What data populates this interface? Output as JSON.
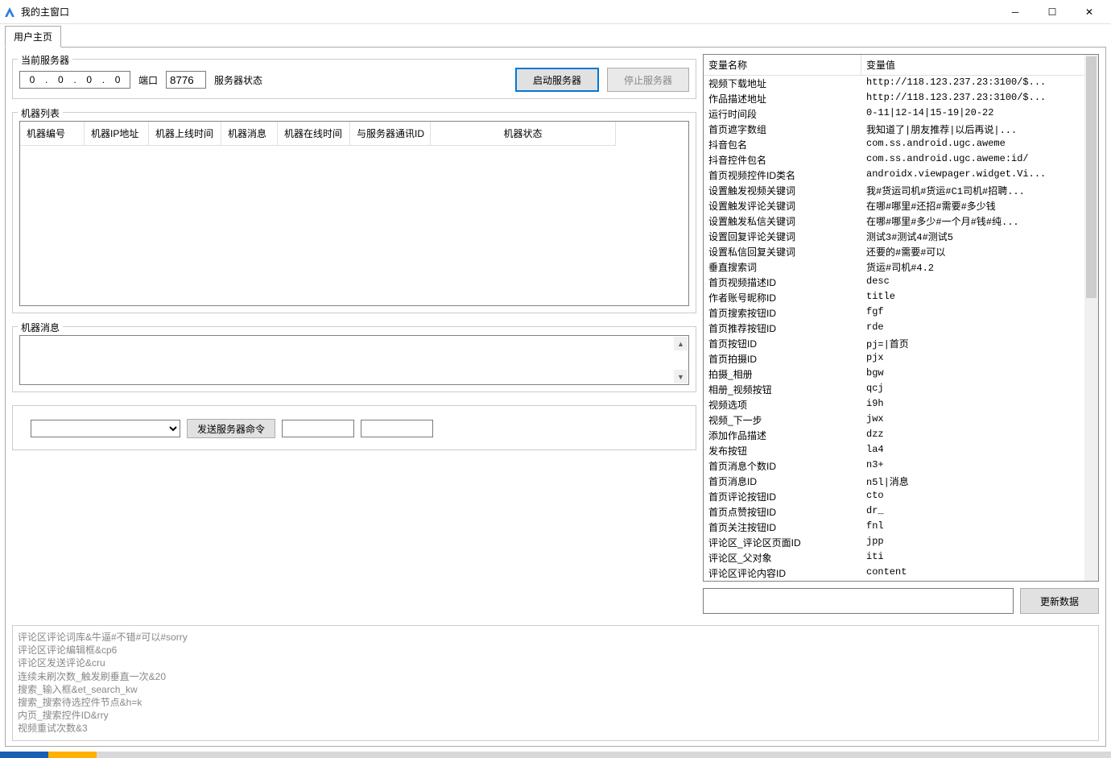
{
  "window": {
    "title": "我的主窗口"
  },
  "tab": {
    "label": "用户主页"
  },
  "server_group": {
    "title": "当前服务器",
    "ip": [
      "0",
      "0",
      "0",
      "0"
    ],
    "port_label": "端口",
    "port_value": "8776",
    "status_label": "服务器状态",
    "start_btn": "启动服务器",
    "stop_btn": "停止服务器"
  },
  "machine_list": {
    "title": "机器列表",
    "headers": [
      "机器编号",
      "机器IP地址",
      "机器上线时间",
      "机器消息",
      "机器在线时间",
      "与服务器通讯ID",
      "机器状态"
    ]
  },
  "machine_msg": {
    "title": "机器消息"
  },
  "command": {
    "send_btn": "发送服务器命令"
  },
  "log_lines": [
    "评论区评论词库&牛逼#不错#可以#sorry",
    "评论区评论编辑框&cp6",
    "评论区发送评论&cru",
    "连续未刷次数_触发刷垂直一次&20",
    "搜索_输入框&et_search_kw",
    "搜索_搜索待选控件节点&h=k",
    "内页_搜索控件ID&rry",
    "视频重试次数&3"
  ],
  "var_table": {
    "header_name": "变量名称",
    "header_value": "变量值",
    "rows": [
      {
        "name": "视频下载地址",
        "value": "http://118.123.237.23:3100/$..."
      },
      {
        "name": "作品描述地址",
        "value": "http://118.123.237.23:3100/$..."
      },
      {
        "name": "运行时间段",
        "value": "0-11|12-14|15-19|20-22"
      },
      {
        "name": "首页遮字数组",
        "value": "我知道了|朋友推荐|以后再说|..."
      },
      {
        "name": "抖音包名",
        "value": "com.ss.android.ugc.aweme"
      },
      {
        "name": "抖音控件包名",
        "value": "com.ss.android.ugc.aweme:id/"
      },
      {
        "name": "首页视频控件ID类名",
        "value": "androidx.viewpager.widget.Vi..."
      },
      {
        "name": "设置触发视频关键词",
        "value": "我#货运司机#货运#C1司机#招聘..."
      },
      {
        "name": "设置触发评论关键词",
        "value": "在哪#哪里#还招#需要#多少钱"
      },
      {
        "name": "设置触发私信关键词",
        "value": "在哪#哪里#多少#一个月#钱#纯..."
      },
      {
        "name": "设置回复评论关键词",
        "value": "测试3#测试4#测试5"
      },
      {
        "name": "设置私信回复关键词",
        "value": "还要的#需要#可以"
      },
      {
        "name": "垂直搜索词",
        "value": "货运#司机#4.2"
      },
      {
        "name": "首页视频描述ID",
        "value": "desc"
      },
      {
        "name": "作者账号昵称ID",
        "value": "title"
      },
      {
        "name": "首页搜索按钮ID",
        "value": "fgf"
      },
      {
        "name": "首页推荐按钮ID",
        "value": "rde"
      },
      {
        "name": "首页按钮ID",
        "value": "pj=|首页"
      },
      {
        "name": "首页拍摄ID",
        "value": "pjx"
      },
      {
        "name": "拍摄_相册",
        "value": "bgw"
      },
      {
        "name": "相册_视频按钮",
        "value": "qcj"
      },
      {
        "name": "视频选项",
        "value": "i9h"
      },
      {
        "name": "视频_下一步",
        "value": "jwx"
      },
      {
        "name": "添加作品描述",
        "value": "dzz"
      },
      {
        "name": "发布按钮",
        "value": "la4"
      },
      {
        "name": "首页消息个数ID",
        "value": "n3+"
      },
      {
        "name": "首页消息ID",
        "value": "n5l|消息"
      },
      {
        "name": "首页评论按钮ID",
        "value": "cto"
      },
      {
        "name": "首页点赞按钮ID",
        "value": "dr_"
      },
      {
        "name": "首页关注按钮ID",
        "value": "fnl"
      },
      {
        "name": "评论区_评论区页面ID",
        "value": "jpp"
      },
      {
        "name": "评论区_父对象",
        "value": "iti"
      },
      {
        "name": "评论区评论内容ID",
        "value": "content"
      }
    ]
  },
  "update_btn": "更新数据"
}
